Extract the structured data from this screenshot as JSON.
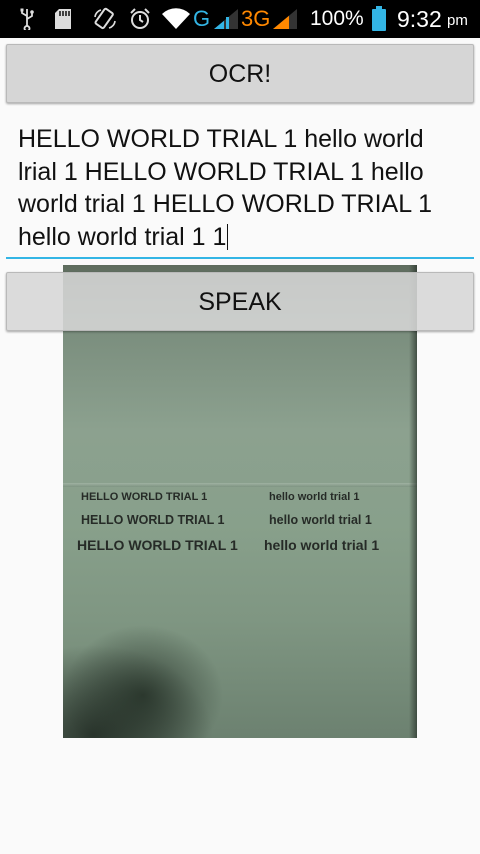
{
  "status_bar": {
    "icons": [
      "usb-icon",
      "sd-card-icon",
      "screen-rotation-icon",
      "alarm-icon",
      "wifi-icon",
      "signal-g-icon",
      "signal-3g-icon",
      "battery-icon"
    ],
    "network_g": "G",
    "network_3g": "3G",
    "battery_percent": "100%",
    "time": "9:32",
    "ampm": "pm",
    "colors": {
      "g": "#33b5e5",
      "threeg": "#ff8800",
      "battery": "#33b5e5"
    }
  },
  "ocr_button": {
    "label": "OCR!"
  },
  "recognized_text": {
    "lines": [
      "HELLO WORLD TRIAL 1 hello world",
      "lrial 1 HELLO WORLD TRIAL 1 hello",
      "world trial 1 HELLO WORLD TRIAL 1",
      "hello world trial 1 1"
    ],
    "accent_color": "#33b5e5"
  },
  "speak_button": {
    "label": "SPEAK"
  },
  "photo": {
    "rows": [
      {
        "left": "HELLO WORLD   TRIAL 1",
        "right": "hello world  trial 1"
      },
      {
        "left": "HELLO WORLD   TRIAL 1",
        "right": "hello world  trial 1"
      },
      {
        "left": "HELLO WORLD TRIAL 1",
        "right": "hello world  trial 1"
      }
    ]
  }
}
